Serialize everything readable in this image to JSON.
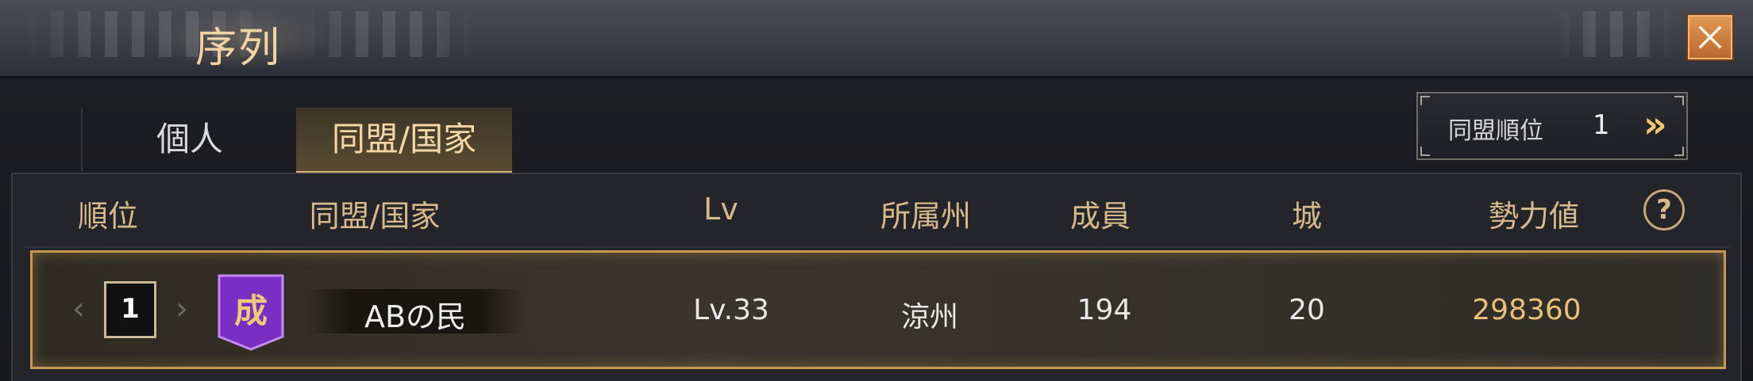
{
  "window": {
    "title": "序列"
  },
  "tabs": [
    {
      "label": "個人",
      "active": false
    },
    {
      "label": "同盟/国家",
      "active": true
    }
  ],
  "alliance_rank": {
    "label": "同盟順位",
    "value": "1"
  },
  "table": {
    "headers": [
      "順位",
      "同盟/国家",
      "Lv",
      "所属州",
      "成員",
      "城",
      "勢力値"
    ],
    "rows": [
      {
        "rank": "1",
        "emblem": "成",
        "name": "ABの民",
        "level": "Lv.33",
        "state": "涼州",
        "members": "194",
        "cities": "20",
        "power": "298360"
      }
    ]
  },
  "colors": {
    "accent_gold": "#d7b98a",
    "emblem_purple": "#7a2ec4",
    "close_orange": "#d0823e"
  },
  "icons": {
    "close": "close-icon",
    "help": "help-icon",
    "forward": "double-chevron-right-icon"
  }
}
